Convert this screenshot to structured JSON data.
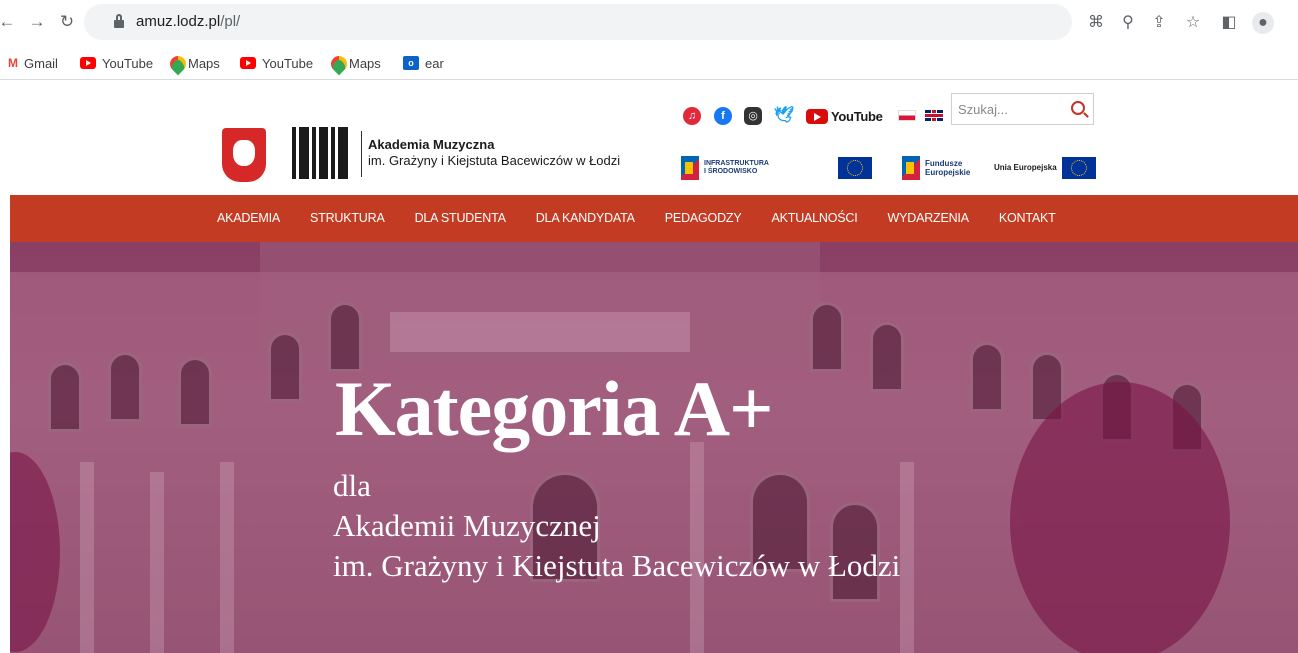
{
  "browser": {
    "url_host": "amuz.lodz.pl",
    "url_path": "/pl/",
    "bookmarks": [
      {
        "label": "Gmail",
        "icon": "gmail-icon"
      },
      {
        "label": "YouTube",
        "icon": "youtube-icon"
      },
      {
        "label": "Maps",
        "icon": "maps-icon"
      },
      {
        "label": "YouTube",
        "icon": "youtube-icon"
      },
      {
        "label": "Maps",
        "icon": "maps-icon"
      },
      {
        "label": "ear",
        "icon": "outlook-icon"
      }
    ]
  },
  "header": {
    "name_line1": "Akademia Muzyczna",
    "name_line2": "im. Grażyny i Kiejstuta Bacewiczów w Łodzi",
    "youtube_label": "YouTube",
    "search_placeholder": "Szukaj...",
    "funding": {
      "infra_line1": "INFRASTRUKTURA",
      "infra_line2": "I ŚRODOWISKO",
      "fe_line1": "Fundusze",
      "fe_line2": "Europejskie",
      "ue_title": "Unia Europejska"
    }
  },
  "nav": {
    "items": [
      "AKADEMIA",
      "STRUKTURA",
      "DLA STUDENTA",
      "DLA KANDYDATA",
      "PEDAGODZY",
      "AKTUALNOŚCI",
      "WYDARZENIA",
      "KONTAKT"
    ]
  },
  "hero": {
    "title": "Kategoria A+",
    "line1": "dla",
    "line2": "Akademii Muzycznej",
    "line3": "im. Grażyny i Kiejstuta Bacewiczów w Łodzi"
  },
  "colors": {
    "nav_background": "#c23b22",
    "hero_overlay": "#8a3f64",
    "accent_red": "#c33527"
  }
}
